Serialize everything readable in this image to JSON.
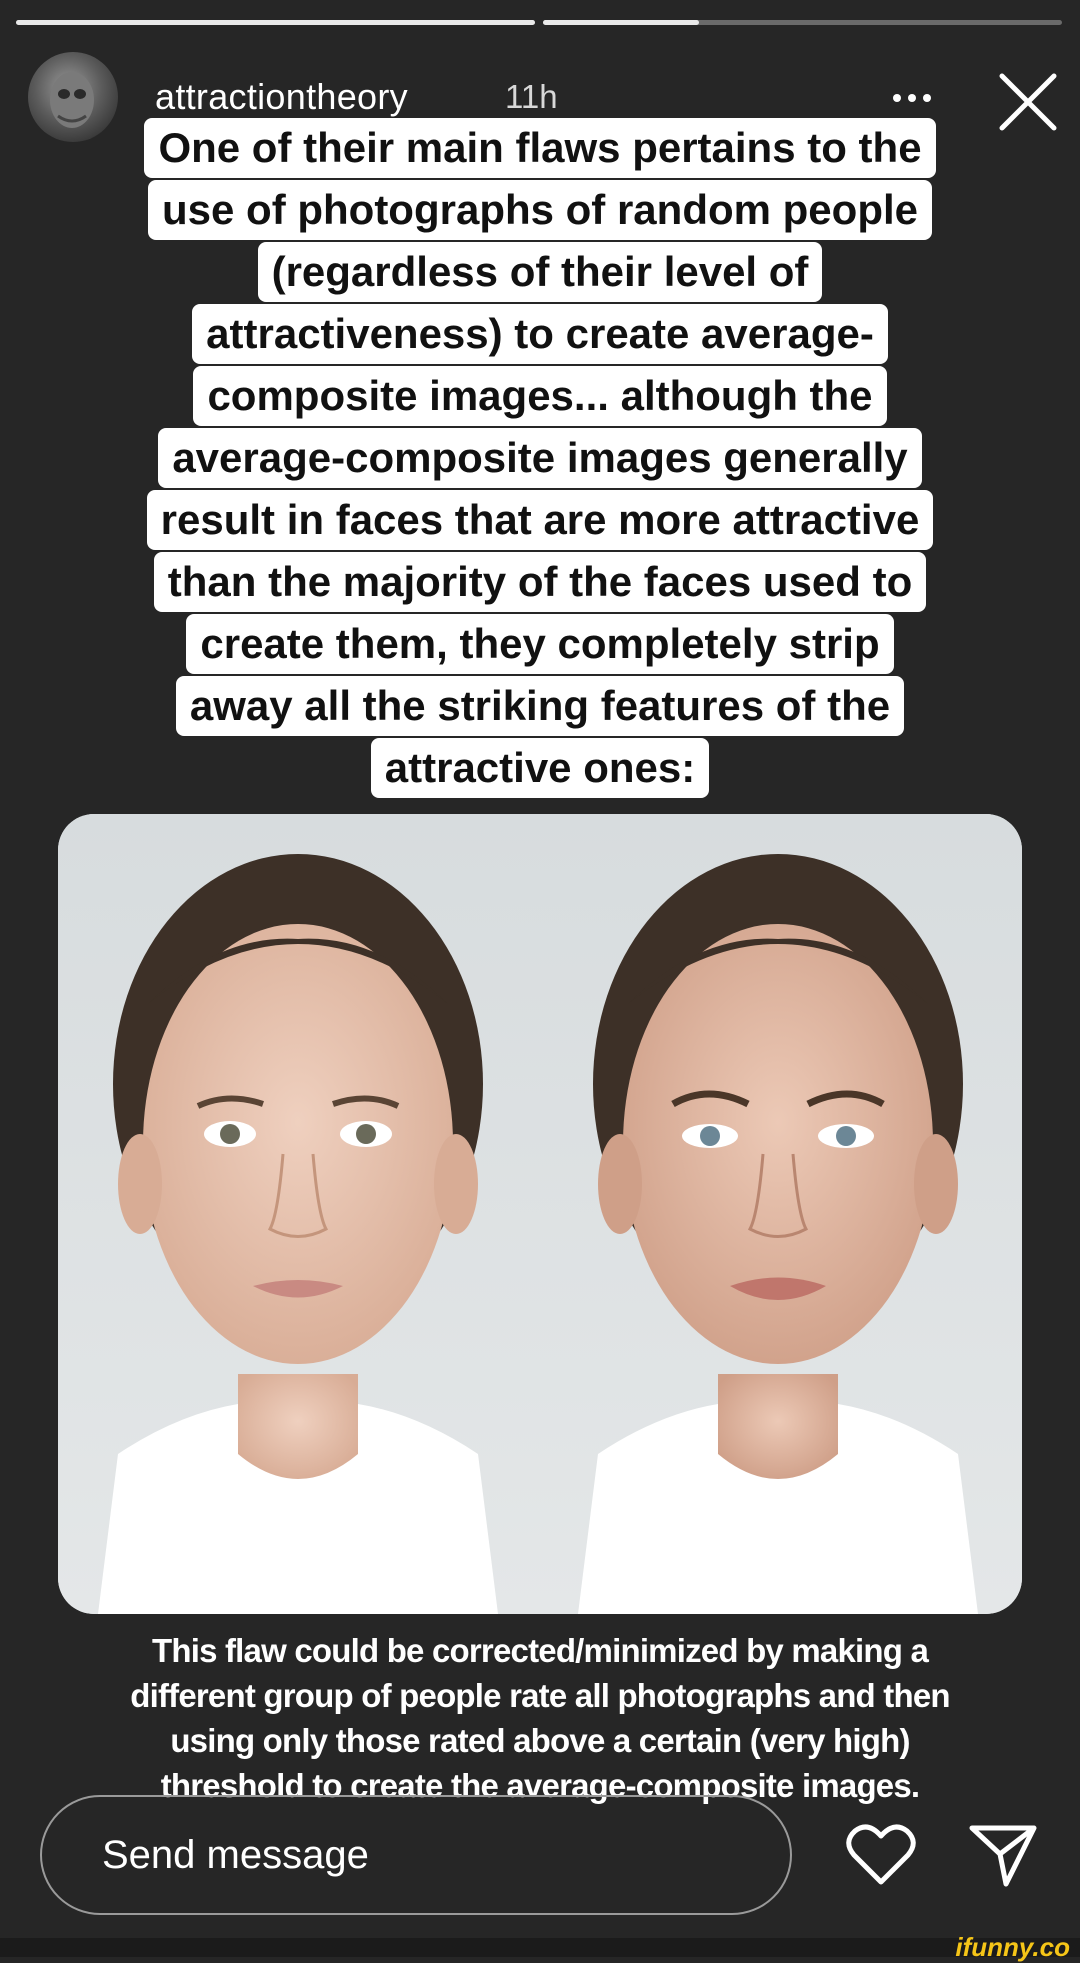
{
  "story": {
    "progress": [
      1.0,
      0.3
    ],
    "username": "attractiontheory",
    "timestamp": "11h",
    "more_icon": "ellipsis-icon",
    "close_icon": "close-icon"
  },
  "caption": {
    "lines": [
      "One of their main flaws pertains to the",
      "use of photographs of random people",
      "(regardless of their level of",
      "attractiveness) to create average-",
      "composite images... although the",
      "average-composite images generally",
      "result in faces that are more attractive",
      "than the majority of the faces used to",
      "create them, they completely strip",
      "away all the striking features of the",
      "attractive ones:"
    ]
  },
  "image": {
    "content": "two-face-comparison-photo"
  },
  "footnote": {
    "lines": [
      "This flaw could be corrected/minimized by making a",
      "different group of people rate all photographs and then",
      "using only those rated above a certain (very high)",
      "threshold to create the average-composite images."
    ]
  },
  "reply": {
    "placeholder": "Send message",
    "like_icon": "heart-icon",
    "share_icon": "send-icon"
  },
  "watermark": "ifunny.co",
  "colors": {
    "background": "#262626",
    "caption_bg": "#ffffff",
    "watermark": "#f5c518"
  }
}
